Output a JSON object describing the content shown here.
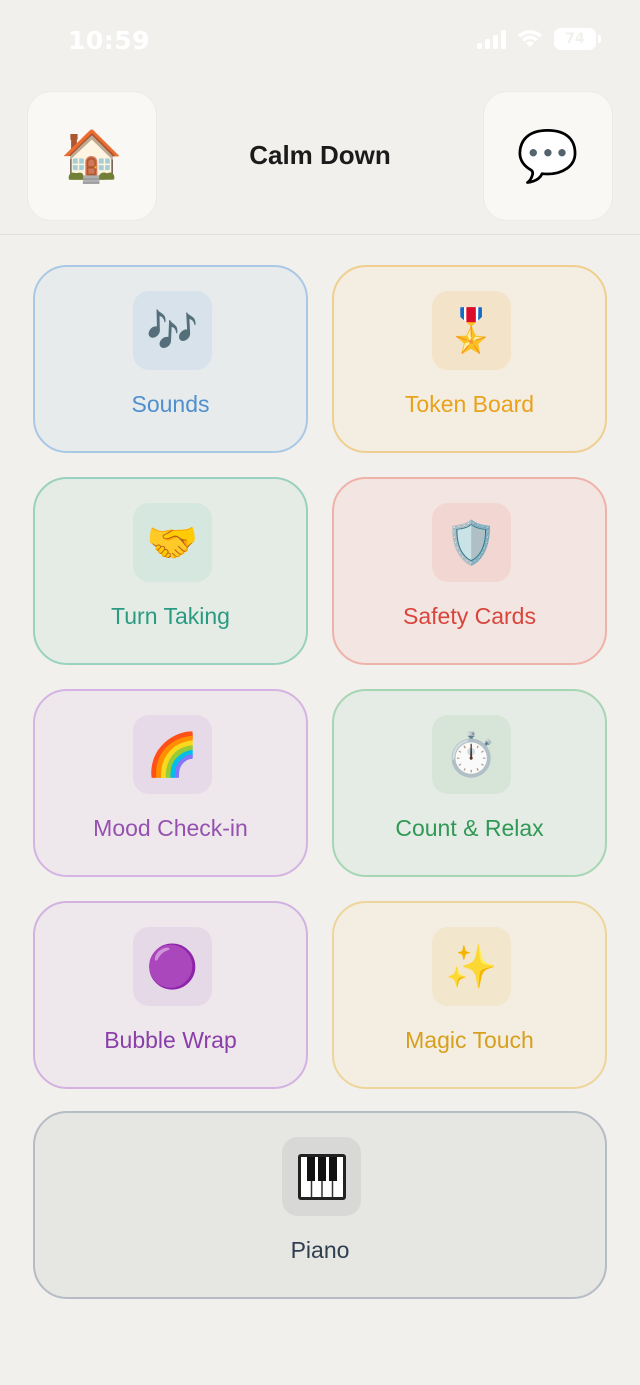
{
  "status_bar": {
    "time": "10:59",
    "battery": "74"
  },
  "header": {
    "title": "Calm Down",
    "home_icon": "🏠",
    "chat_icon": "💬"
  },
  "tiles": [
    {
      "label": "Sounds",
      "icon": "🎶",
      "color": "#4f8fce",
      "border": "#a9c8e6",
      "bg": "#e7ebec",
      "icon_bg": "#d7e2ea"
    },
    {
      "label": "Token Board",
      "icon": "🎖️",
      "color": "#e8a21c",
      "border": "#efcf8f",
      "bg": "#f4ede1",
      "icon_bg": "#f3e3c8"
    },
    {
      "label": "Turn Taking",
      "icon": "🤝",
      "color": "#2a9b82",
      "border": "#98d1bf",
      "bg": "#e5ece6",
      "icon_bg": "#d5e7de"
    },
    {
      "label": "Safety Cards",
      "icon": "🛡️",
      "color": "#d9453b",
      "border": "#efb2a8",
      "bg": "#f3e5e1",
      "icon_bg": "#f2d6d1"
    },
    {
      "label": "Mood Check-in",
      "icon": "🌈",
      "color": "#9651b0",
      "border": "#d5b3e2",
      "bg": "#eee8ec",
      "icon_bg": "#e6d9e8"
    },
    {
      "label": "Count & Relax",
      "icon": "⏱️",
      "color": "#2f9955",
      "border": "#a6d6b3",
      "bg": "#e5ece5",
      "icon_bg": "#d6e5d7"
    },
    {
      "label": "Bubble Wrap",
      "icon": "🟣",
      "color": "#8a3fa8",
      "border": "#d3b2e1",
      "bg": "#eee8ec",
      "icon_bg": "#e5d9e7"
    },
    {
      "label": "Magic Touch",
      "icon": "✨",
      "color": "#d79f1e",
      "border": "#eed59b",
      "bg": "#f3eee1",
      "icon_bg": "#f2e6cc"
    }
  ],
  "piano": {
    "label": "Piano",
    "icon": "🎹"
  }
}
